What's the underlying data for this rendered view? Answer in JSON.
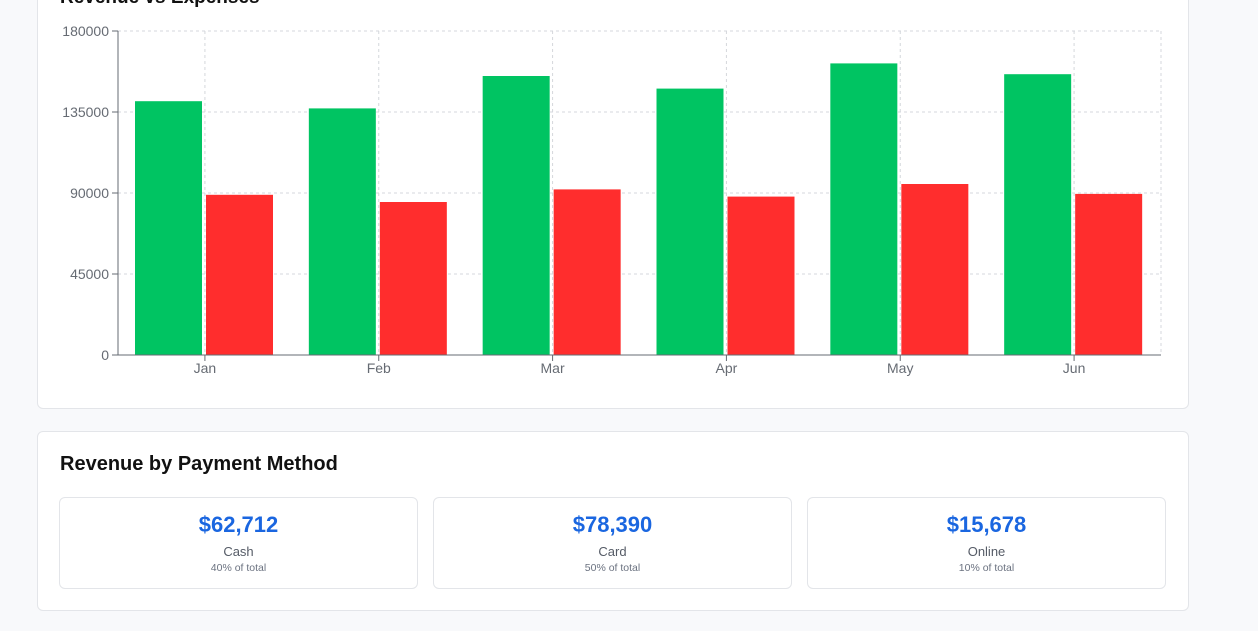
{
  "chart_section": {
    "title": "Revenue vs Expenses"
  },
  "chart_data": {
    "type": "bar",
    "categories": [
      "Jan",
      "Feb",
      "Mar",
      "Apr",
      "May",
      "Jun"
    ],
    "series": [
      {
        "values": [
          141000,
          137000,
          155000,
          148000,
          162000,
          156000
        ],
        "color": "#00c462"
      },
      {
        "values": [
          89000,
          85000,
          92000,
          88000,
          95000,
          89500
        ],
        "color": "#ff2d2d"
      }
    ],
    "yticks": [
      "0",
      "45000",
      "90000",
      "135000",
      "180000"
    ],
    "ylim": [
      0,
      180000
    ],
    "grid": true
  },
  "payment_section": {
    "title": "Revenue by Payment Method",
    "methods": [
      {
        "amount": "$62,712",
        "label": "Cash",
        "share": "40% of total"
      },
      {
        "amount": "$78,390",
        "label": "Card",
        "share": "50% of total"
      },
      {
        "amount": "$15,678",
        "label": "Online",
        "share": "10% of total"
      }
    ],
    "accent_color": "#1a66e0"
  }
}
